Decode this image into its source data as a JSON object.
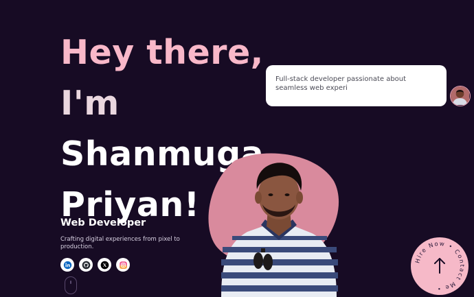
{
  "hero": {
    "line1": "Hey there,",
    "line2": "I'm",
    "line3": "Shanmuga",
    "line4": "Priyan!"
  },
  "role": "Web Developer",
  "tagline": "Crafting digital experiences from pixel to production.",
  "socials": [
    {
      "name": "linkedin-icon",
      "color": "#0a66c2"
    },
    {
      "name": "github-icon",
      "color": "#24292f"
    },
    {
      "name": "x-icon",
      "color": "#000000"
    },
    {
      "name": "instagram-icon",
      "color": "#dd2a7b"
    }
  ],
  "chat": {
    "message": "Full-stack developer passionate about seamless web experi"
  },
  "contact_badge": {
    "text": "Hire Now • Contact Me •"
  },
  "colors": {
    "background": "#170b24",
    "accent_pink": "#f9b8c9",
    "blob": "#d98a9d"
  }
}
